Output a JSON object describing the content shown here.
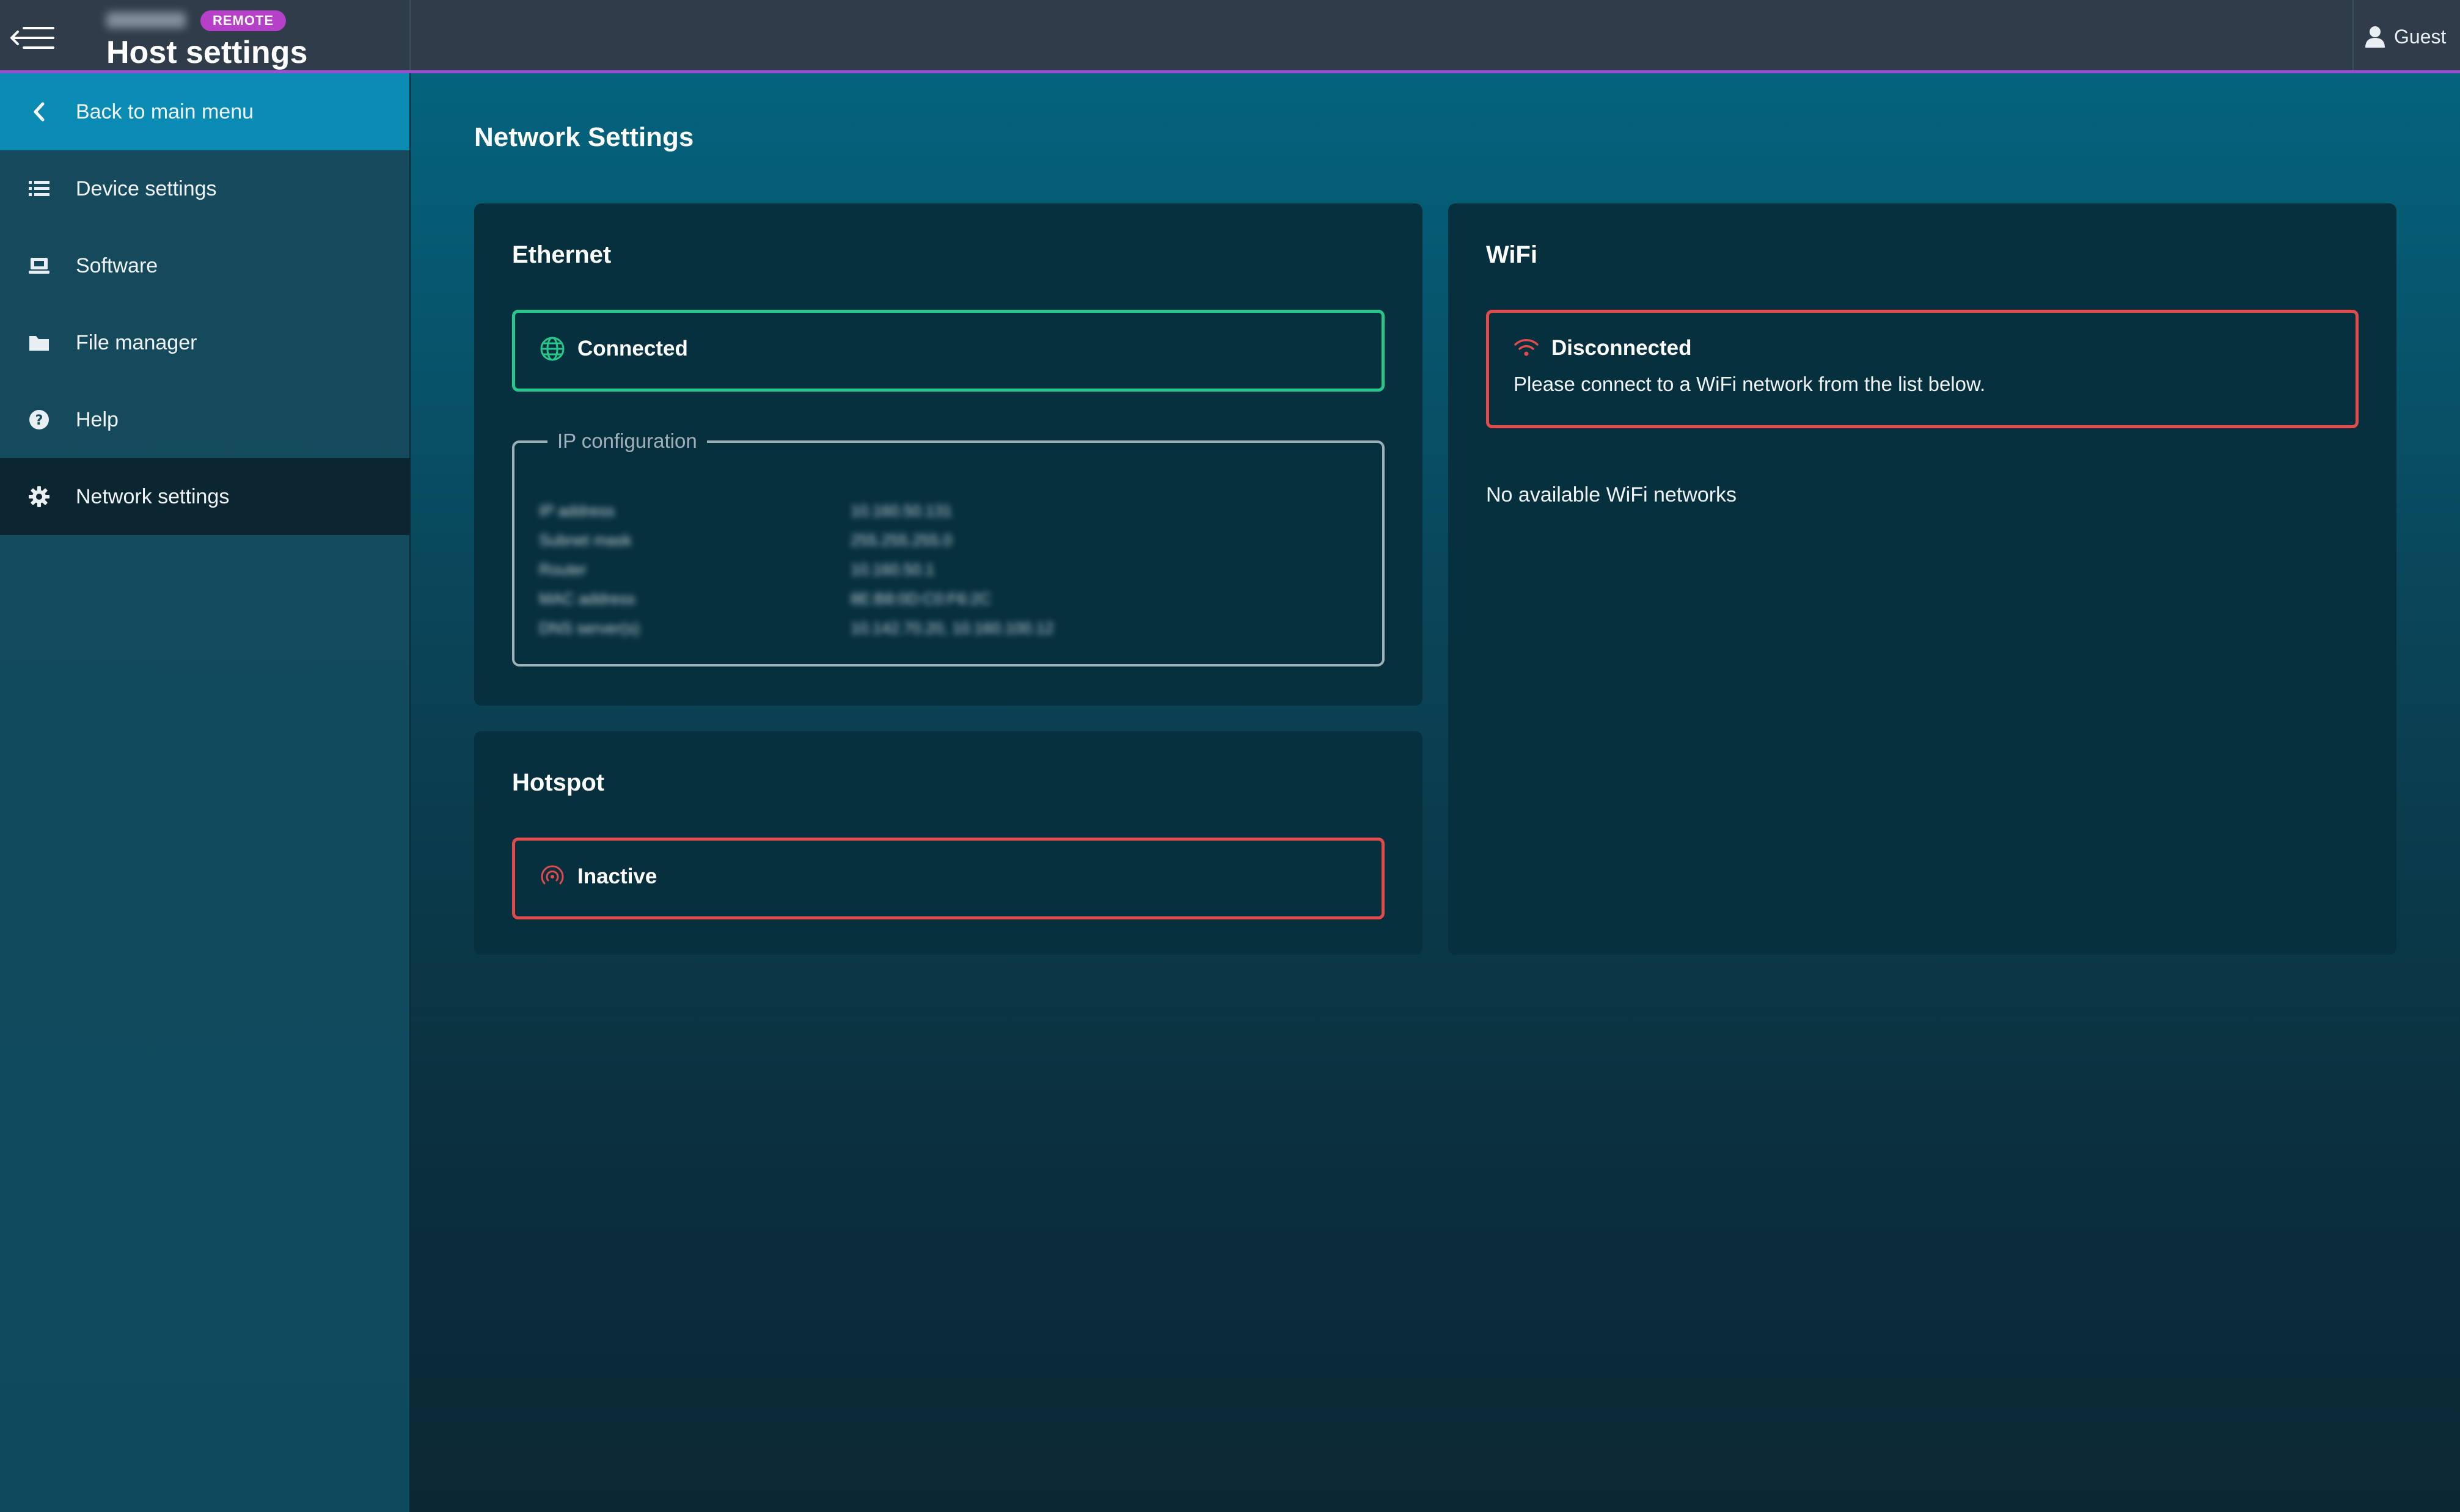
{
  "header": {
    "badge": "REMOTE",
    "title": "Host settings",
    "user": "Guest",
    "accent_color": "#9b4fd0"
  },
  "sidebar": {
    "items": [
      {
        "label": "Back to main menu",
        "icon": "chevron-left-icon"
      },
      {
        "label": "Device settings",
        "icon": "list-icon"
      },
      {
        "label": "Software",
        "icon": "monitor-icon"
      },
      {
        "label": "File manager",
        "icon": "folder-icon"
      },
      {
        "label": "Help",
        "icon": "question-circle-icon"
      },
      {
        "label": "Network settings",
        "icon": "gear-icon",
        "active": true
      }
    ]
  },
  "main": {
    "title": "Network Settings",
    "ethernet": {
      "title": "Ethernet",
      "status": "Connected",
      "status_color": "#27c68a",
      "ip_config": {
        "legend": "IP configuration",
        "rows": [
          {
            "key": "IP address",
            "value": "10.160.50.131"
          },
          {
            "key": "Subnet mask",
            "value": "255.255.255.0"
          },
          {
            "key": "Router",
            "value": "10.160.50.1"
          },
          {
            "key": "MAC address",
            "value": "8E:B8:0D:C0:F6:2C"
          },
          {
            "key": "DNS server(s)",
            "value": "10.142.70.20, 10.160.100.12"
          }
        ]
      }
    },
    "hotspot": {
      "title": "Hotspot",
      "status": "Inactive",
      "status_color": "#e24b4b"
    },
    "wifi": {
      "title": "WiFi",
      "status": "Disconnected",
      "status_color": "#e24b4b",
      "detail": "Please connect to a WiFi network from the list below.",
      "empty_message": "No available WiFi networks"
    }
  }
}
